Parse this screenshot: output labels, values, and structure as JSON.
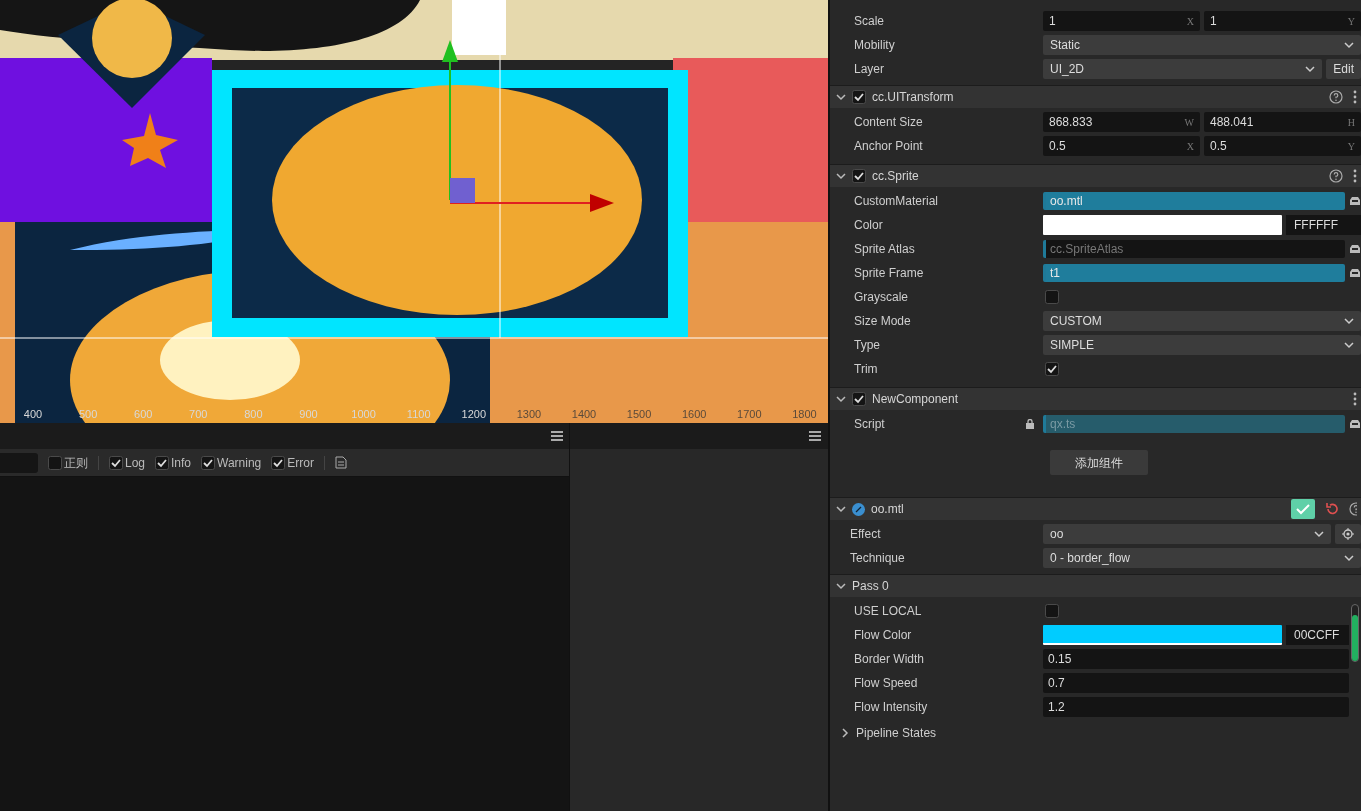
{
  "scene": {
    "ruler_labels": [
      "400",
      "500",
      "600",
      "700",
      "800",
      "900",
      "1000",
      "1100",
      "1200",
      "1300",
      "1400",
      "1500",
      "1600",
      "1700",
      "1800"
    ]
  },
  "console": {
    "regex": {
      "label": "正则",
      "checked": false
    },
    "filters": [
      {
        "label": "Log",
        "checked": true
      },
      {
        "label": "Info",
        "checked": true
      },
      {
        "label": "Warning",
        "checked": true
      },
      {
        "label": "Error",
        "checked": true
      }
    ]
  },
  "inspector": {
    "node_rows": [
      {
        "kind": "vec2",
        "label": "Scale",
        "values": [
          {
            "value": "1",
            "axis": "X"
          },
          {
            "value": "1",
            "axis": "Y"
          }
        ]
      },
      {
        "kind": "select",
        "label": "Mobility",
        "value": "Static"
      },
      {
        "kind": "select",
        "label": "Layer",
        "value": "UI_2D",
        "button": "Edit"
      }
    ],
    "components": [
      {
        "title": "cc.UITransform",
        "enabled": true,
        "expanded": true,
        "help": true,
        "rows": [
          {
            "kind": "vec2",
            "label": "Content Size",
            "values": [
              {
                "value": "868.833",
                "axis": "W"
              },
              {
                "value": "488.041",
                "axis": "H"
              }
            ]
          },
          {
            "kind": "vec2",
            "label": "Anchor Point",
            "values": [
              {
                "value": "0.5",
                "axis": "X"
              },
              {
                "value": "0.5",
                "axis": "Y"
              }
            ]
          }
        ]
      },
      {
        "title": "cc.Sprite",
        "enabled": true,
        "expanded": true,
        "help": true,
        "rows": [
          {
            "kind": "asset",
            "label": "CustomMaterial",
            "value": "oo.mtl",
            "filled": true
          },
          {
            "kind": "color",
            "label": "Color",
            "color": "#ffffff",
            "hex": "FFFFFF"
          },
          {
            "kind": "asset",
            "label": "Sprite Atlas",
            "placeholder": "cc.SpriteAtlas",
            "filled": false
          },
          {
            "kind": "asset",
            "label": "Sprite Frame",
            "value": "t1",
            "filled": true
          },
          {
            "kind": "checkbox",
            "label": "Grayscale",
            "checked": false
          },
          {
            "kind": "select",
            "label": "Size Mode",
            "value": "CUSTOM"
          },
          {
            "kind": "select",
            "label": "Type",
            "value": "SIMPLE"
          },
          {
            "kind": "checkbox",
            "label": "Trim",
            "checked": true
          }
        ]
      },
      {
        "title": "NewComponent",
        "enabled": true,
        "expanded": true,
        "help": false,
        "rows": [
          {
            "kind": "script",
            "label": "Script",
            "value": "qx.ts",
            "locked": true
          }
        ]
      }
    ],
    "add_component_button": "添加组件",
    "material": {
      "title": "oo.mtl",
      "expanded": true,
      "rows": [
        {
          "kind": "select",
          "label": "Effect",
          "value": "oo",
          "locate": true
        },
        {
          "kind": "select",
          "label": "Technique",
          "value": "0 - border_flow"
        }
      ],
      "pass": {
        "title": "Pass 0",
        "expanded": true,
        "rows": [
          {
            "kind": "checkbox",
            "label": "USE LOCAL",
            "checked": false
          },
          {
            "kind": "color",
            "label": "Flow Color",
            "color": "#00ccff",
            "hex": "00CCFF"
          },
          {
            "kind": "number",
            "label": "Border Width",
            "value": "0.15"
          },
          {
            "kind": "number",
            "label": "Flow Speed",
            "value": "0.7"
          },
          {
            "kind": "number",
            "label": "Flow Intensity",
            "value": "1.2"
          }
        ],
        "pipeline": {
          "title": "Pipeline States",
          "expanded": false
        }
      }
    }
  }
}
